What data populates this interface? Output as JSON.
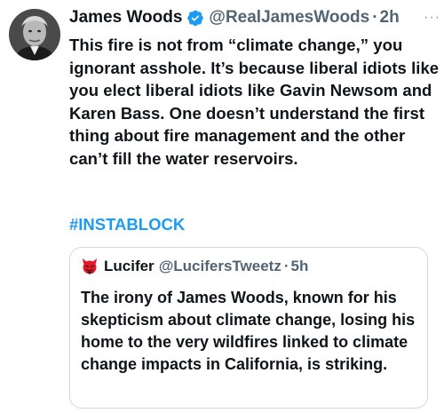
{
  "tweet": {
    "author_name": "James Woods",
    "handle": "@RealJamesWoods",
    "separator": "·",
    "time": "2h",
    "more": "···",
    "text": "This fire is not from “climate change,” you ignorant asshole. It’s because liberal idiots like you elect liberal idiots like Gavin Newsom and Karen Bass. One doesn’t understand the first thing about fire management and the other can’t fill the water reservoirs.",
    "hashtag": "#INSTABLOCK",
    "avatar_icon": "profile-photo",
    "verified_icon": "verified-badge-icon"
  },
  "quote": {
    "author_name": "Lucifer",
    "handle": "@LucifersTweetz",
    "separator": "·",
    "time": "5h",
    "text": "The irony of James Woods, known for his skepticism about climate change, losing his home to the very wildfires linked to climate change impacts in California, is striking.",
    "avatar_icon": "devil-avatar-icon"
  },
  "colors": {
    "text": "#0f1419",
    "secondary": "#536471",
    "accent": "#1d9bf0",
    "border": "#cfd9de",
    "quote_avatar": "#e0192b"
  }
}
